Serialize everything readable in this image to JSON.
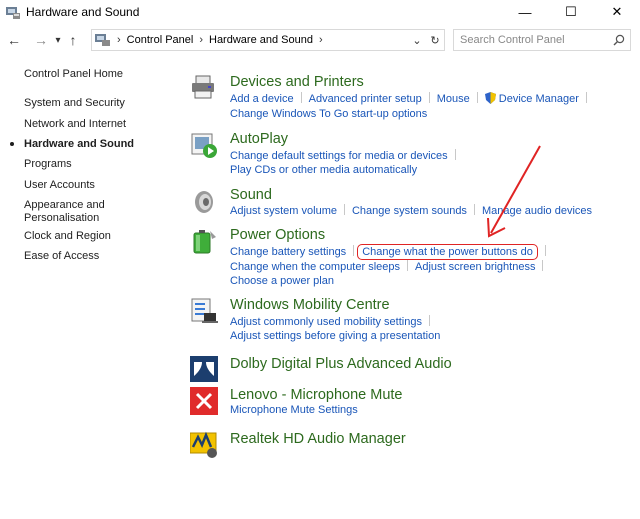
{
  "window": {
    "title": "Hardware and Sound",
    "minimize": "—",
    "maximize": "☐",
    "close": "✕"
  },
  "nav": {
    "back": "←",
    "forward": "→",
    "recent": "▾",
    "up": "↑"
  },
  "breadcrumb": [
    "Control Panel",
    "Hardware and Sound"
  ],
  "breadcrumb_sep": "›",
  "addr_dropdown": "⌄",
  "addr_refresh": "↻",
  "search": {
    "placeholder": "Search Control Panel"
  },
  "left_nav": [
    "Control Panel Home",
    "System and Security",
    "Network and Internet",
    "Hardware and Sound",
    "Programs",
    "User Accounts",
    "Appearance and",
    "Personalisation",
    "Clock and Region",
    "Ease of Access"
  ],
  "categories": {
    "devices": {
      "title": "Devices and Printers",
      "row1": [
        "Add a device",
        "Advanced printer setup",
        "Mouse",
        "Device Manager"
      ],
      "row2": [
        "Change Windows To Go start-up options"
      ]
    },
    "autoplay": {
      "title": "AutoPlay",
      "row1": [
        "Change default settings for media or devices"
      ],
      "row2": [
        "Play CDs or other media automatically"
      ]
    },
    "sound": {
      "title": "Sound",
      "row1": [
        "Adjust system volume",
        "Change system sounds",
        "Manage audio devices"
      ]
    },
    "power": {
      "title": "Power Options",
      "row1": [
        "Change battery settings",
        "Change what the power buttons do"
      ],
      "row2": [
        "Change when the computer sleeps",
        "Adjust screen brightness"
      ],
      "row3": [
        "Choose a power plan"
      ]
    },
    "mobility": {
      "title": "Windows Mobility Centre",
      "row1": [
        "Adjust commonly used mobility settings"
      ],
      "row2": [
        "Adjust settings before giving a presentation"
      ]
    },
    "dolby": {
      "title": "Dolby Digital Plus Advanced Audio"
    },
    "lenovo": {
      "title": "Lenovo - Microphone Mute",
      "row1": [
        "Microphone Mute Settings"
      ]
    },
    "realtek": {
      "title": "Realtek HD Audio Manager"
    }
  },
  "colors": {
    "link": "#1a56b8",
    "category_title": "#2d6a1e",
    "annotation": "#e02424"
  }
}
